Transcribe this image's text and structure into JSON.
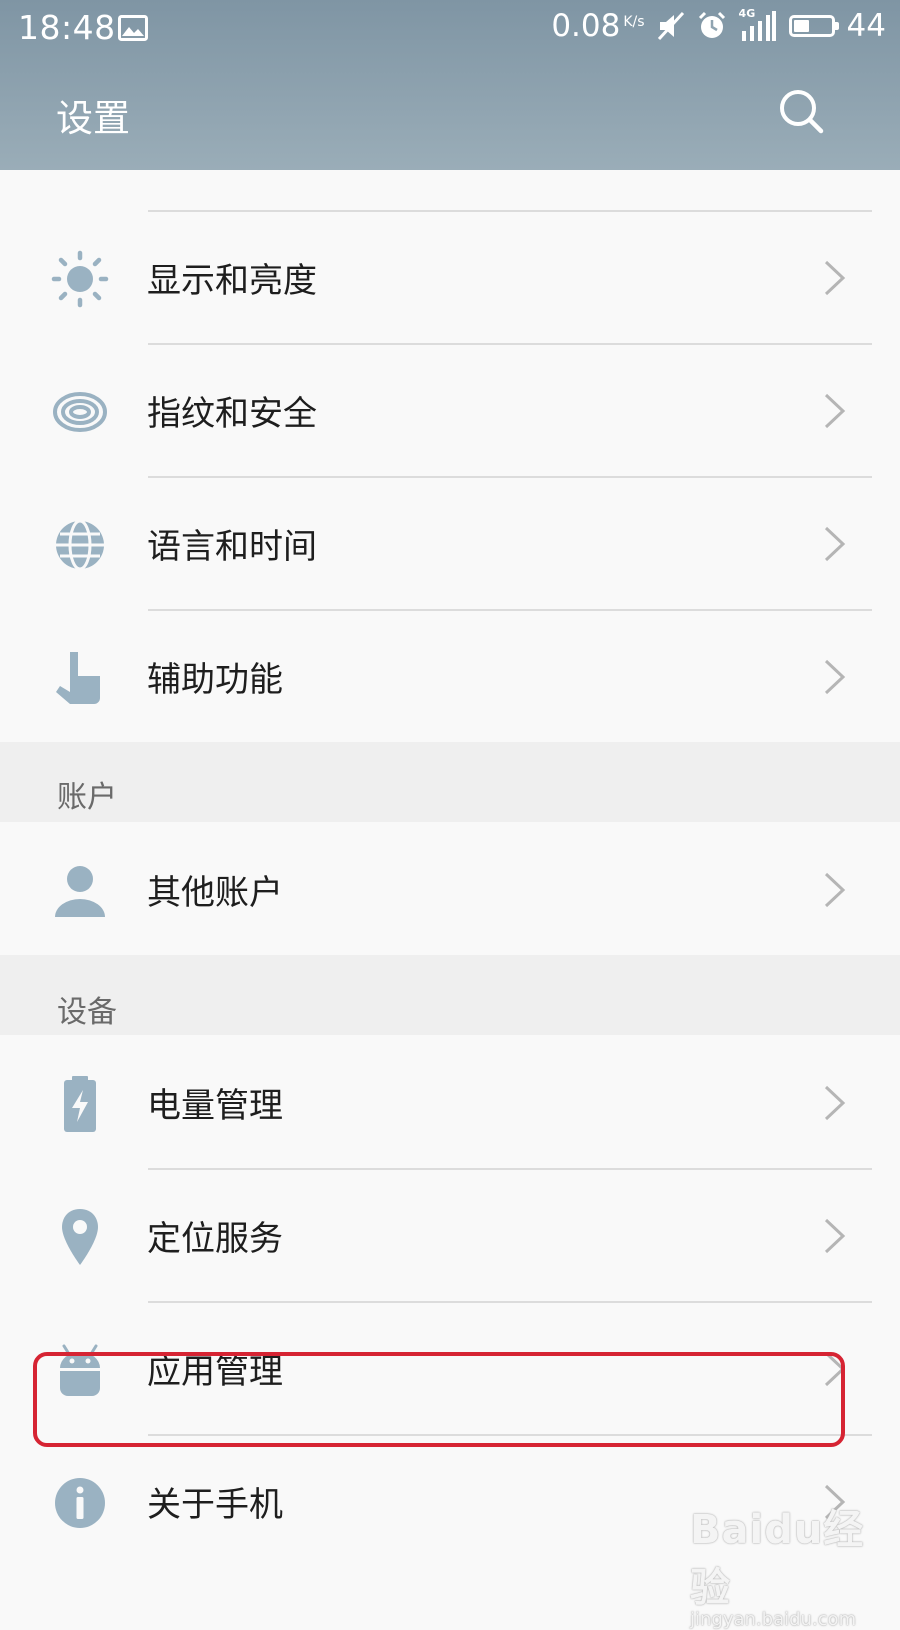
{
  "status_bar": {
    "time": "18:48",
    "net_speed": "0.08",
    "net_unit": "K/s",
    "network": "4G",
    "battery": "44",
    "battery_level": 0.44
  },
  "header": {
    "title": "设置",
    "search_icon": "search-icon"
  },
  "colors": {
    "appbar": "#8fa4b1",
    "icon": "#9ab2c2",
    "highlight": "#d62433"
  },
  "sections": [
    {
      "title": "",
      "items": [
        {
          "label": "显示和亮度",
          "icon": "brightness-icon"
        },
        {
          "label": "指纹和安全",
          "icon": "fingerprint-icon"
        },
        {
          "label": "语言和时间",
          "icon": "globe-icon"
        },
        {
          "label": "辅助功能",
          "icon": "hand-pointer-icon"
        }
      ]
    },
    {
      "title": "账户",
      "items": [
        {
          "label": "其他账户",
          "icon": "person-icon"
        }
      ]
    },
    {
      "title": "设备",
      "items": [
        {
          "label": "电量管理",
          "icon": "battery-charge-icon"
        },
        {
          "label": "定位服务",
          "icon": "location-pin-icon"
        },
        {
          "label": "应用管理",
          "icon": "android-icon",
          "highlighted": true
        },
        {
          "label": "关于手机",
          "icon": "info-icon"
        }
      ]
    }
  ],
  "watermark": {
    "brand": "Baidu经验",
    "url": "jingyan.baidu.com"
  }
}
